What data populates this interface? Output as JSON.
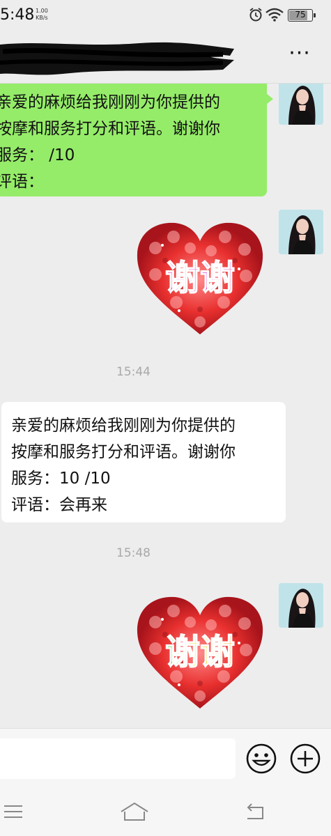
{
  "status_bar": {
    "time": "5:48",
    "speed_value": "1.00",
    "speed_unit": "KB/s",
    "battery": "75",
    "battery_level": 0.75
  },
  "header": {
    "title": "",
    "more_label": "···"
  },
  "messages": {
    "green_bubble": {
      "lines": [
        "亲爱的麻烦给我刚刚为你提供的",
        "按摩和服务打分和评语。谢谢你",
        "服务： /10",
        "评语："
      ]
    },
    "sticker1": {
      "text": "谢谢"
    },
    "timestamp1": "15:44",
    "white_bubble": {
      "lines": [
        "亲爱的麻烦给我刚刚为你提供的",
        "按摩和服务打分和评语。谢谢你",
        "服务：10 /10",
        "评语：会再来"
      ]
    },
    "timestamp2": "15:48",
    "sticker2": {
      "text": "谢谢"
    }
  },
  "input_bar": {
    "placeholder": "",
    "emoji_icon": "smiley-icon",
    "plus_icon": "plus-circle-icon"
  },
  "nav_bar": {
    "menu_icon": "menu-icon",
    "home_icon": "home-icon",
    "back_icon": "back-icon"
  },
  "colors": {
    "green_bubble": "#95ec69",
    "background": "#ededed",
    "white_bubble": "#ffffff"
  }
}
